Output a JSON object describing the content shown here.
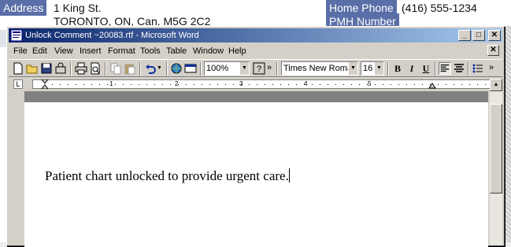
{
  "background_app": {
    "address_label": "Address",
    "address_line1": "1 King St.",
    "address_line2": "TORONTO, ON, Can. M5G 2C2",
    "home_phone_label": "Home Phone",
    "home_phone_value": "(416) 555-1234",
    "second_label": "PMH Number"
  },
  "window": {
    "title": "Unlock Comment ~20083.rtf - Microsoft Word",
    "minimize": "_",
    "maximize": "□",
    "close": "✕"
  },
  "menu": {
    "items": [
      "File",
      "Edit",
      "View",
      "Insert",
      "Format",
      "Tools",
      "Table",
      "Window",
      "Help"
    ],
    "doc_close": "✕"
  },
  "toolbar": {
    "zoom": "100%",
    "font_name": "Times New Roma",
    "font_size": "16",
    "bold": "B",
    "italic": "I",
    "underline": "U",
    "more": "»"
  },
  "ruler": {
    "numbers": [
      "1",
      "2",
      "3",
      "4",
      "5"
    ]
  },
  "document": {
    "text": "Patient chart unlocked to provide urgent care."
  },
  "colors": {
    "title_start": "#0a246a",
    "title_end": "#a6caf0",
    "bg_label": "#5a6fa8",
    "face": "#d4d0c8"
  }
}
